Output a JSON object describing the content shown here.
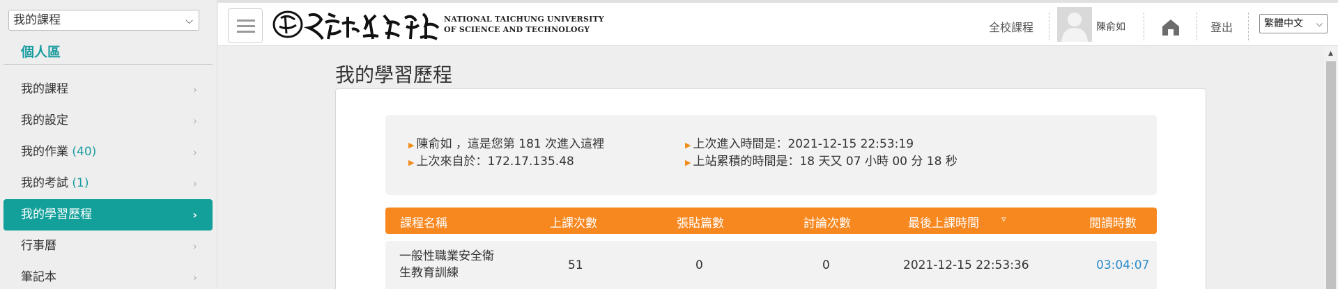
{
  "sidebar": {
    "course_select": "我的課程",
    "personal_label": "個人區",
    "items": [
      {
        "label": "我的課程",
        "count": ""
      },
      {
        "label": "我的設定",
        "count": ""
      },
      {
        "label": "我的作業",
        "count": " (40)"
      },
      {
        "label": "我的考試",
        "count": " (1)"
      },
      {
        "label": "我的學習歷程",
        "count": ""
      },
      {
        "label": "行事曆",
        "count": ""
      },
      {
        "label": "筆記本",
        "count": ""
      }
    ],
    "active_index": 4
  },
  "header": {
    "logo_text_en_line1": "NATIONAL TAICHUNG UNIVERSITY",
    "logo_text_en_line2": "OF SCIENCE AND TECHNOLOGY",
    "all_courses": "全校課程",
    "user_name": "陳俞如",
    "logout": "登出",
    "language": "繁體中文"
  },
  "main": {
    "title": "我的學習歷程",
    "info": {
      "visit_count": "陳俞如 ，這是您第 181 次進入這裡",
      "from_ip": "上次來自於：172.17.135.48",
      "last_login": "上次進入時間是：2021-12-15 22:53:19",
      "total_time": "上站累積的時間是：18 天又 07 小時 00 分 18 秒"
    },
    "table": {
      "headers": [
        "課程名稱",
        "上課次數",
        "張貼篇數",
        "討論次數",
        "最後上課時間",
        "閱讀時數"
      ],
      "rows": [
        {
          "course_line1": "一般性職業安全衛",
          "course_line2": "生教育訓練",
          "sessions": "51",
          "posts": "0",
          "discussions": "0",
          "last_time": "2021-12-15 22:53:36",
          "reading_time": "03:04:07"
        }
      ]
    }
  },
  "icons": {
    "sort": "sort-desc-icon",
    "home": "home-icon",
    "menu": "hamburger-icon"
  },
  "colors": {
    "accent_teal": "#13a09a",
    "header_orange": "#f7871f",
    "link_blue": "#2b8bc9"
  }
}
